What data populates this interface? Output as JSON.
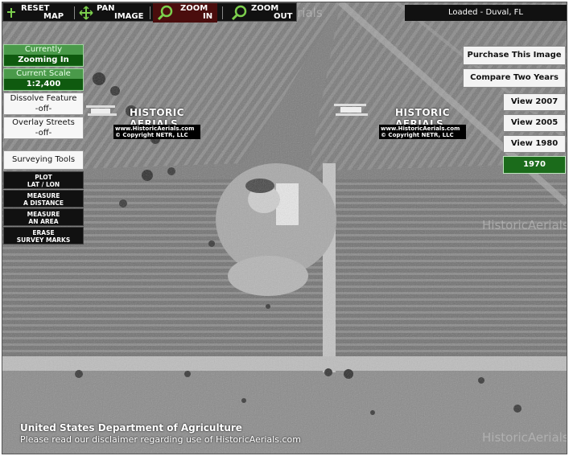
{
  "toolbar": {
    "reset": [
      "RESET",
      "MAP"
    ],
    "pan": [
      "PAN",
      "IMAGE"
    ],
    "zoom_in": [
      "ZOOM",
      "IN"
    ],
    "zoom_out": [
      "ZOOM",
      "OUT"
    ]
  },
  "status": "Loaded - Duval, FL",
  "mode": {
    "label": "Currently",
    "value": "Zooming In"
  },
  "scale": {
    "label": "Current Scale",
    "value": "1:2,400"
  },
  "dissolve": {
    "label": "Dissolve Feature",
    "value": "-off-"
  },
  "overlay": {
    "label": "Overlay Streets",
    "value": "-off-"
  },
  "surveying": {
    "title": "Surveying Tools",
    "tools": [
      [
        "PLOT",
        "LAT / LON"
      ],
      [
        "MEASURE",
        "A DISTANCE"
      ],
      [
        "MEASURE",
        "AN AREA"
      ],
      [
        "ERASE",
        "SURVEY MARKS"
      ]
    ]
  },
  "right_buttons": {
    "purchase": "Purchase This Image",
    "compare": "Compare Two Years",
    "years": [
      "View 2007",
      "View 2005",
      "View 1980",
      "1970"
    ],
    "active_year": "1970"
  },
  "logo": {
    "brand": "HISTORIC AERIALS",
    "url": "www.HistoricAerials.com",
    "copyright": "© Copyright NETR, LLC"
  },
  "watermark": "HistoricAerials",
  "footer": {
    "line1": "United States Department of Agriculture",
    "line2": "Please read our disclaimer regarding use of HistoricAerials.com"
  },
  "colors": {
    "active_green": "#1b6b1b",
    "toolbar_black": "#111111"
  }
}
